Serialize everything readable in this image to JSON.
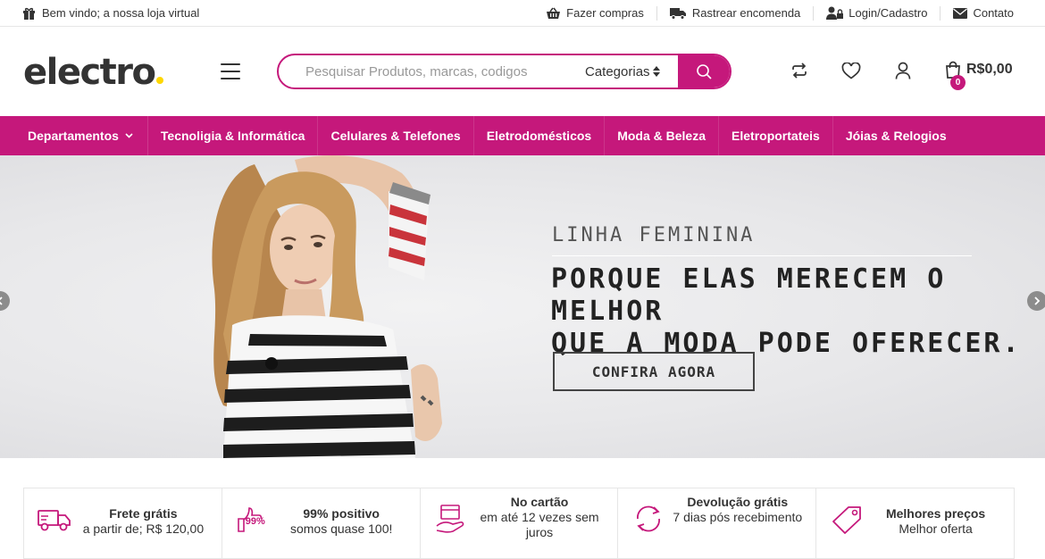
{
  "topbar": {
    "welcome": "Bem vindo; a nossa loja virtual",
    "links": [
      {
        "label": "Fazer compras",
        "icon": "basket-icon"
      },
      {
        "label": "Rastrear encomenda",
        "icon": "truck-icon"
      },
      {
        "label": "Login/Cadastro",
        "icon": "user-lock-icon"
      },
      {
        "label": "Contato",
        "icon": "envelope-icon"
      }
    ]
  },
  "header": {
    "logo": "electro",
    "search": {
      "placeholder": "Pesquisar Produtos, marcas, codigos",
      "category": "Categorias"
    },
    "cart": {
      "count": "0",
      "total": "R$0,00"
    }
  },
  "nav": {
    "items": [
      "Departamentos",
      "Tecnoligia & Informática",
      "Celulares & Telefones",
      "Eletrodomésticos",
      "Moda & Beleza",
      "Eletroportateis",
      "Jóias & Relogios"
    ]
  },
  "hero": {
    "subtitle": "LINHA FEMININA",
    "title": "PORQUE ELAS MERECEM O MELHOR\nQUE A MODA PODE OFERECER.",
    "button": "CONFIRA AGORA"
  },
  "features": [
    {
      "title": "Frete grátis",
      "text": "a partir de; R$ 120,00",
      "icon": "delivery-truck-icon"
    },
    {
      "title": "99% positivo",
      "text": "somos quase 100!",
      "icon": "thumbs-up-icon",
      "badge": "99%"
    },
    {
      "title": "No cartão",
      "text": "em até 12 vezes sem juros",
      "icon": "card-in-hand-icon"
    },
    {
      "title": "Devolução grátis",
      "text": "7 dias pós recebimento",
      "icon": "return-arrows-icon"
    },
    {
      "title": "Melhores preços",
      "text": "Melhor oferta",
      "icon": "price-tag-icon"
    }
  ],
  "colors": {
    "brand": "#c5187b",
    "logo_dot": "#fed700"
  }
}
